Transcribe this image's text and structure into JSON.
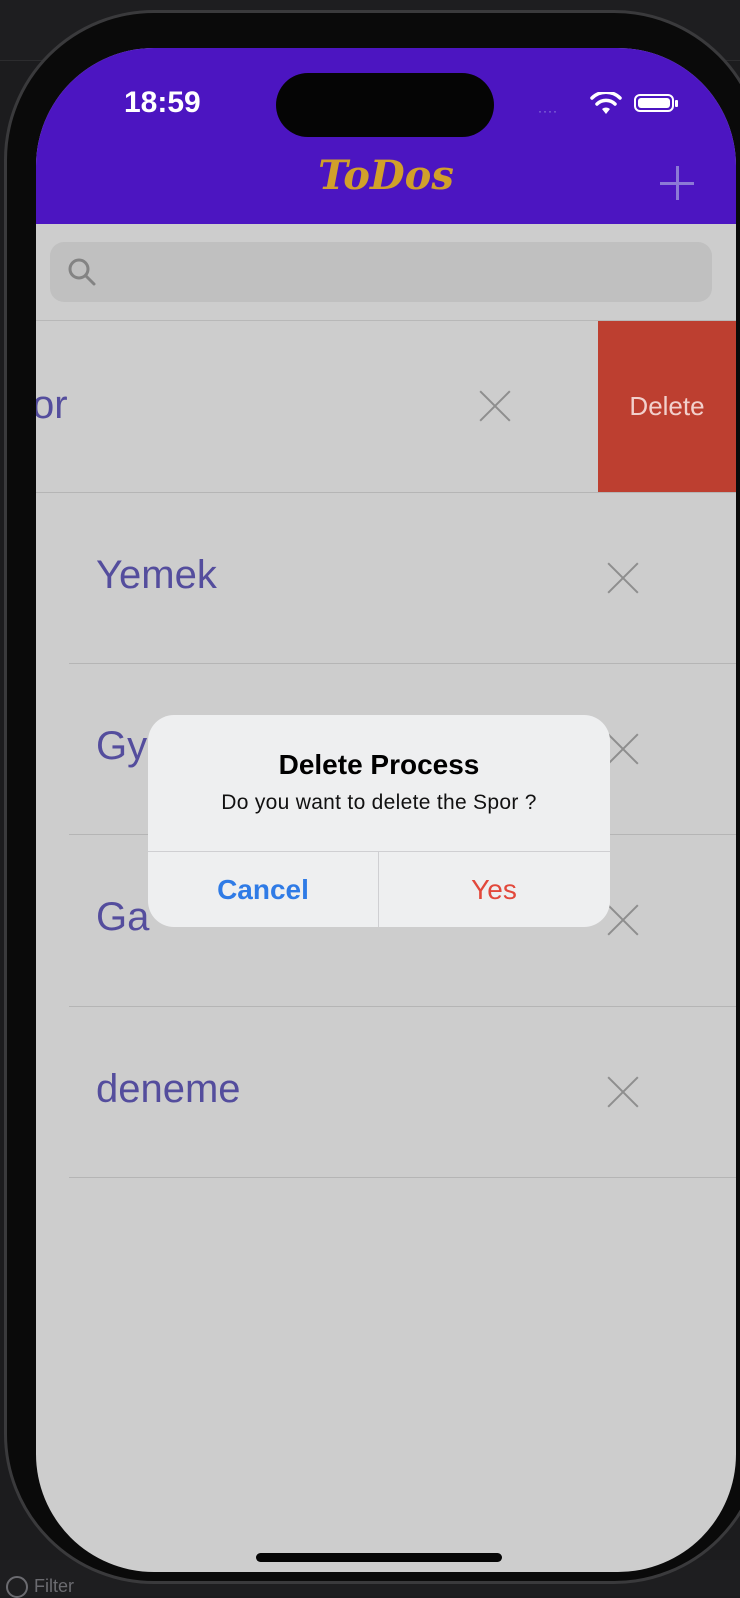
{
  "status_bar": {
    "time": "18:59",
    "signal": "····"
  },
  "navbar": {
    "title": "ToDos",
    "add_icon": "plus-icon"
  },
  "search": {
    "placeholder": "",
    "icon": "search-icon"
  },
  "rows": [
    {
      "label": "or",
      "swiped": true,
      "delete_label": "Delete"
    },
    {
      "label": "Yemek"
    },
    {
      "label": "Gy"
    },
    {
      "label": "Ga"
    },
    {
      "label": "deneme"
    }
  ],
  "alert": {
    "title": "Delete Process",
    "message": "Do you want to delete the Spor ?",
    "cancel_label": "Cancel",
    "yes_label": "Yes"
  },
  "ide": {
    "filter_label": "Filter"
  },
  "colors": {
    "navbar": "#4c15c1",
    "title": "#d1a02a",
    "row_text": "#544d9d",
    "delete": "#bd3f30",
    "cancel": "#2f7be6",
    "yes": "#e2483b"
  }
}
